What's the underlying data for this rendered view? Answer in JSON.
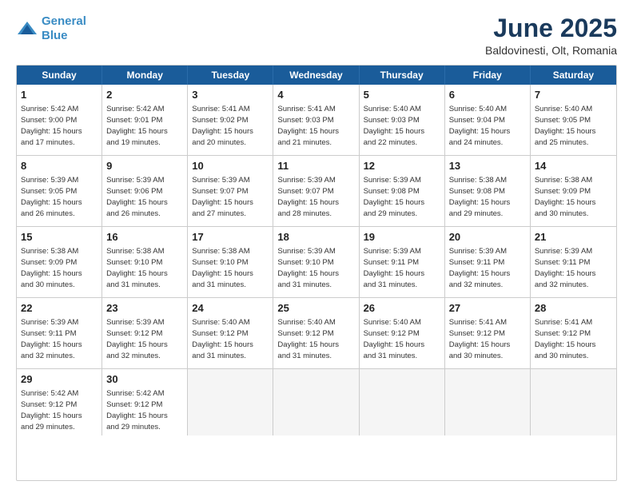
{
  "header": {
    "logo_line1": "General",
    "logo_line2": "Blue",
    "month_year": "June 2025",
    "location": "Baldovinesti, Olt, Romania"
  },
  "weekdays": [
    "Sunday",
    "Monday",
    "Tuesday",
    "Wednesday",
    "Thursday",
    "Friday",
    "Saturday"
  ],
  "weeks": [
    [
      {
        "day": "1",
        "lines": [
          "Sunrise: 5:42 AM",
          "Sunset: 9:00 PM",
          "Daylight: 15 hours",
          "and 17 minutes."
        ]
      },
      {
        "day": "2",
        "lines": [
          "Sunrise: 5:42 AM",
          "Sunset: 9:01 PM",
          "Daylight: 15 hours",
          "and 19 minutes."
        ]
      },
      {
        "day": "3",
        "lines": [
          "Sunrise: 5:41 AM",
          "Sunset: 9:02 PM",
          "Daylight: 15 hours",
          "and 20 minutes."
        ]
      },
      {
        "day": "4",
        "lines": [
          "Sunrise: 5:41 AM",
          "Sunset: 9:03 PM",
          "Daylight: 15 hours",
          "and 21 minutes."
        ]
      },
      {
        "day": "5",
        "lines": [
          "Sunrise: 5:40 AM",
          "Sunset: 9:03 PM",
          "Daylight: 15 hours",
          "and 22 minutes."
        ]
      },
      {
        "day": "6",
        "lines": [
          "Sunrise: 5:40 AM",
          "Sunset: 9:04 PM",
          "Daylight: 15 hours",
          "and 24 minutes."
        ]
      },
      {
        "day": "7",
        "lines": [
          "Sunrise: 5:40 AM",
          "Sunset: 9:05 PM",
          "Daylight: 15 hours",
          "and 25 minutes."
        ]
      }
    ],
    [
      {
        "day": "8",
        "lines": [
          "Sunrise: 5:39 AM",
          "Sunset: 9:05 PM",
          "Daylight: 15 hours",
          "and 26 minutes."
        ]
      },
      {
        "day": "9",
        "lines": [
          "Sunrise: 5:39 AM",
          "Sunset: 9:06 PM",
          "Daylight: 15 hours",
          "and 26 minutes."
        ]
      },
      {
        "day": "10",
        "lines": [
          "Sunrise: 5:39 AM",
          "Sunset: 9:07 PM",
          "Daylight: 15 hours",
          "and 27 minutes."
        ]
      },
      {
        "day": "11",
        "lines": [
          "Sunrise: 5:39 AM",
          "Sunset: 9:07 PM",
          "Daylight: 15 hours",
          "and 28 minutes."
        ]
      },
      {
        "day": "12",
        "lines": [
          "Sunrise: 5:39 AM",
          "Sunset: 9:08 PM",
          "Daylight: 15 hours",
          "and 29 minutes."
        ]
      },
      {
        "day": "13",
        "lines": [
          "Sunrise: 5:38 AM",
          "Sunset: 9:08 PM",
          "Daylight: 15 hours",
          "and 29 minutes."
        ]
      },
      {
        "day": "14",
        "lines": [
          "Sunrise: 5:38 AM",
          "Sunset: 9:09 PM",
          "Daylight: 15 hours",
          "and 30 minutes."
        ]
      }
    ],
    [
      {
        "day": "15",
        "lines": [
          "Sunrise: 5:38 AM",
          "Sunset: 9:09 PM",
          "Daylight: 15 hours",
          "and 30 minutes."
        ]
      },
      {
        "day": "16",
        "lines": [
          "Sunrise: 5:38 AM",
          "Sunset: 9:10 PM",
          "Daylight: 15 hours",
          "and 31 minutes."
        ]
      },
      {
        "day": "17",
        "lines": [
          "Sunrise: 5:38 AM",
          "Sunset: 9:10 PM",
          "Daylight: 15 hours",
          "and 31 minutes."
        ]
      },
      {
        "day": "18",
        "lines": [
          "Sunrise: 5:39 AM",
          "Sunset: 9:10 PM",
          "Daylight: 15 hours",
          "and 31 minutes."
        ]
      },
      {
        "day": "19",
        "lines": [
          "Sunrise: 5:39 AM",
          "Sunset: 9:11 PM",
          "Daylight: 15 hours",
          "and 31 minutes."
        ]
      },
      {
        "day": "20",
        "lines": [
          "Sunrise: 5:39 AM",
          "Sunset: 9:11 PM",
          "Daylight: 15 hours",
          "and 32 minutes."
        ]
      },
      {
        "day": "21",
        "lines": [
          "Sunrise: 5:39 AM",
          "Sunset: 9:11 PM",
          "Daylight: 15 hours",
          "and 32 minutes."
        ]
      }
    ],
    [
      {
        "day": "22",
        "lines": [
          "Sunrise: 5:39 AM",
          "Sunset: 9:11 PM",
          "Daylight: 15 hours",
          "and 32 minutes."
        ]
      },
      {
        "day": "23",
        "lines": [
          "Sunrise: 5:39 AM",
          "Sunset: 9:12 PM",
          "Daylight: 15 hours",
          "and 32 minutes."
        ]
      },
      {
        "day": "24",
        "lines": [
          "Sunrise: 5:40 AM",
          "Sunset: 9:12 PM",
          "Daylight: 15 hours",
          "and 31 minutes."
        ]
      },
      {
        "day": "25",
        "lines": [
          "Sunrise: 5:40 AM",
          "Sunset: 9:12 PM",
          "Daylight: 15 hours",
          "and 31 minutes."
        ]
      },
      {
        "day": "26",
        "lines": [
          "Sunrise: 5:40 AM",
          "Sunset: 9:12 PM",
          "Daylight: 15 hours",
          "and 31 minutes."
        ]
      },
      {
        "day": "27",
        "lines": [
          "Sunrise: 5:41 AM",
          "Sunset: 9:12 PM",
          "Daylight: 15 hours",
          "and 30 minutes."
        ]
      },
      {
        "day": "28",
        "lines": [
          "Sunrise: 5:41 AM",
          "Sunset: 9:12 PM",
          "Daylight: 15 hours",
          "and 30 minutes."
        ]
      }
    ],
    [
      {
        "day": "29",
        "lines": [
          "Sunrise: 5:42 AM",
          "Sunset: 9:12 PM",
          "Daylight: 15 hours",
          "and 29 minutes."
        ]
      },
      {
        "day": "30",
        "lines": [
          "Sunrise: 5:42 AM",
          "Sunset: 9:12 PM",
          "Daylight: 15 hours",
          "and 29 minutes."
        ]
      },
      {
        "day": "",
        "lines": []
      },
      {
        "day": "",
        "lines": []
      },
      {
        "day": "",
        "lines": []
      },
      {
        "day": "",
        "lines": []
      },
      {
        "day": "",
        "lines": []
      }
    ]
  ]
}
